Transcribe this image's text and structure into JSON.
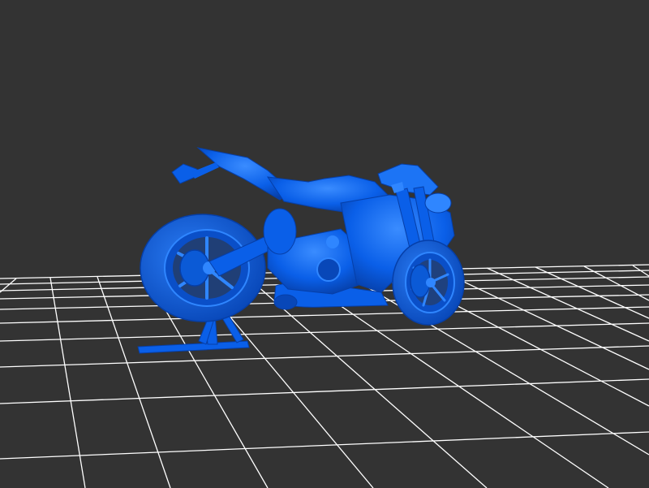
{
  "viewport": {
    "background_color": "#333333"
  },
  "grid": {
    "line_color": "#ffffff",
    "visible": true
  },
  "model": {
    "icon": "motorcycle-icon",
    "color": "#0a5fe8",
    "highlight_color": "#2f86ff",
    "shadow_color": "#043a9e",
    "has_paddock_stand": true
  }
}
